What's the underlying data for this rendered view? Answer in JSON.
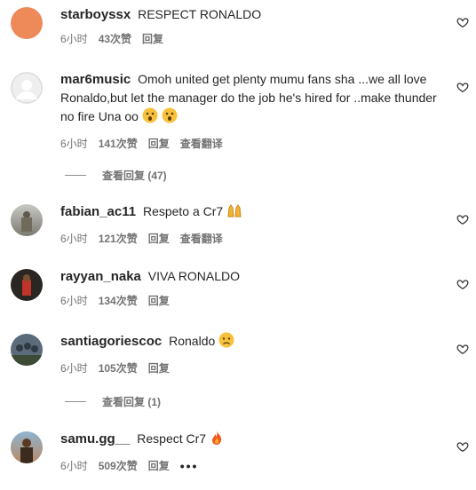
{
  "comments": [
    {
      "user": "starboyssx",
      "text": "RESPECT RONALDO",
      "time": "6小时",
      "likes": "43次赞",
      "reply": "回复",
      "translate": ""
    },
    {
      "user": "mar6music",
      "text": "Omoh united get plenty mumu fans sha ...we all love Ronaldo,but let the manager do the job he's hired for ..make thunder no fire Una oo",
      "time": "6小时",
      "likes": "141次赞",
      "reply": "回复",
      "translate": "查看翻译",
      "view_replies": "查看回复 (47)"
    },
    {
      "user": "fabian_ac11",
      "text": "Respeto a Cr7",
      "time": "6小时",
      "likes": "121次赞",
      "reply": "回复",
      "translate": "查看翻译"
    },
    {
      "user": "rayyan_naka",
      "text": "VIVA RONALDO",
      "time": "6小时",
      "likes": "134次赞",
      "reply": "回复",
      "translate": ""
    },
    {
      "user": "santiagoriescoc",
      "text": "Ronaldo",
      "time": "6小时",
      "likes": "105次赞",
      "reply": "回复",
      "translate": "",
      "view_replies": "查看回复 (1)"
    },
    {
      "user": "samu.gg__",
      "text": "Respect Cr7",
      "time": "6小时",
      "likes": "509次赞",
      "reply": "回复",
      "translate": "",
      "more": "•••"
    }
  ],
  "icons": {
    "heart": "heart-outline-icon",
    "emoji_shock": "astonished-face-emoji",
    "emoji_hands": "raised-hands-emoji",
    "emoji_sad": "worried-face-emoji",
    "emoji_fire": "fire-emoji"
  },
  "colors": {
    "text": "#262626",
    "meta": "#737373",
    "avatar_orange": "#ee8a5a"
  }
}
